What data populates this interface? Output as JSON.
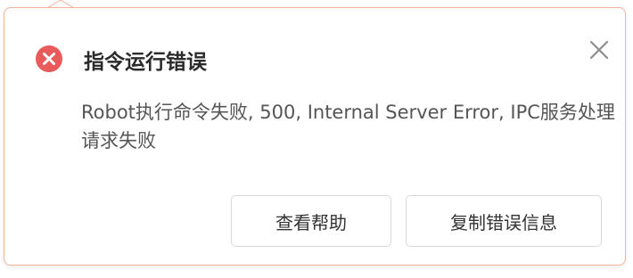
{
  "dialog": {
    "title": "指令运行错误",
    "message": " Robot执行命令失败, 500, Internal Server Error, IPC服务处理请求失败",
    "status_icon": "error-circle-icon",
    "close_icon": "close-icon"
  },
  "buttons": {
    "help_label": "查看帮助",
    "copy_label": "复制错误信息"
  },
  "colors": {
    "accent_border": "#f3b49c",
    "error_red": "#e95a5a",
    "title_text": "#2b2b2b",
    "body_text": "#555555"
  }
}
